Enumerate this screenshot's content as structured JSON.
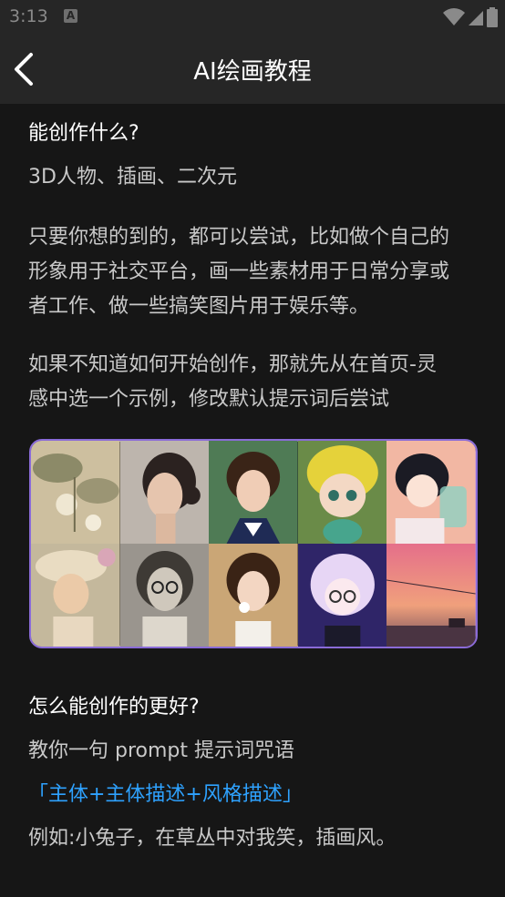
{
  "status": {
    "time": "3:13"
  },
  "appbar": {
    "title": "AI绘画教程"
  },
  "sections": {
    "q1": "能创作什么?",
    "a1": "3D人物、插画、二次元",
    "p1_l1": "只要你想的到的，都可以尝试，比如做个自己的",
    "p1_l2": "形象用于社交平台，画一些素材用于日常分享或",
    "p1_l3": "者工作、做一些搞笑图片用于娱乐等。",
    "p2_l1": "如果不知道如何开始创作，那就先从在首页-灵",
    "p2_l2": "感中选一个示例，修改默认提示词后尝试",
    "q2": "怎么能创作的更好?",
    "tip": "教你一句 prompt 提示词咒语",
    "formula": "「主体+主体描述+风格描述」",
    "example": "例如:小兔子，在草丛中对我笑，插画风。"
  },
  "gallery": {
    "tiles": [
      {
        "name": "lotus-painting",
        "bg": "#cfc2a6"
      },
      {
        "name": "portrait-woman-bun",
        "bg": "#b9b1aa"
      },
      {
        "name": "girl-braids-sailor",
        "bg": "#4e7a54"
      },
      {
        "name": "3d-yellow-hat-figure",
        "bg": "#5b7f3e"
      },
      {
        "name": "anime-girl-jar",
        "bg": "#f1b6a4"
      },
      {
        "name": "vintage-woman-hat",
        "bg": "#b9a791"
      },
      {
        "name": "sketch-woman-glasses",
        "bg": "#8f8a84"
      },
      {
        "name": "girl-flower-mouth",
        "bg": "#c3a171"
      },
      {
        "name": "anime-girl-glasses",
        "bg": "#3a2c6e"
      },
      {
        "name": "sunset-landscape",
        "bg": "#e8887c"
      }
    ]
  }
}
